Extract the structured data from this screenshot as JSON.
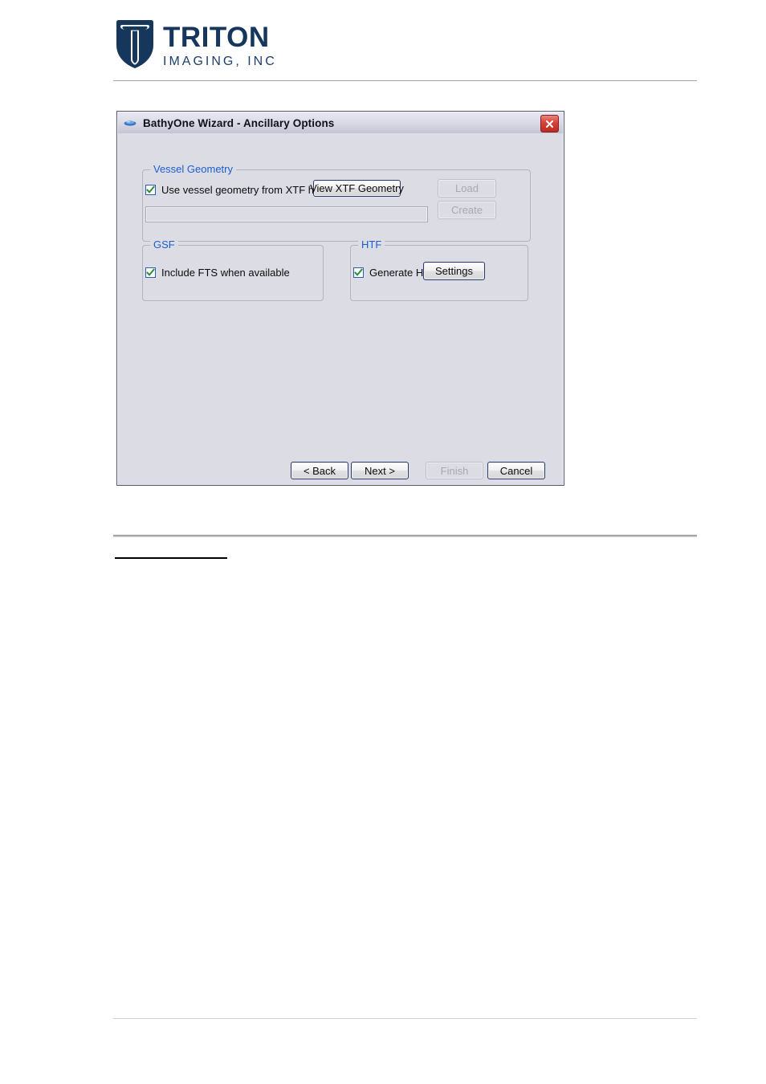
{
  "page": {
    "header": {
      "logo": {
        "shield_icon": "triton-shield-icon",
        "title": "TRITON",
        "subtitle": "IMAGING, INC",
        "brand_color": "#16365c"
      }
    }
  },
  "dialog": {
    "titlebar": {
      "icon": "bathyone-wave-icon",
      "title": "BathyOne Wizard - Ancillary Options",
      "close_icon": "close-icon",
      "close_color": "#c8342a"
    },
    "groups": {
      "vessel_geometry": {
        "legend": "Vessel Geometry",
        "legend_color": "#1b5ecb",
        "checkbox": {
          "label": "Use vessel geometry from XTF header",
          "checked": true,
          "check_color": "#2e8b34"
        },
        "view_button": {
          "label": "View XTF Geometry",
          "enabled": true,
          "focused": true
        },
        "path_field": {
          "value": "",
          "placeholder": "",
          "enabled": false
        },
        "load_button": {
          "label": "Load",
          "enabled": false
        },
        "create_button": {
          "label": "Create",
          "enabled": false
        }
      },
      "gsf": {
        "legend": "GSF",
        "checkbox": {
          "label": "Include FTS when available",
          "checked": true
        }
      },
      "htf": {
        "legend": "HTF",
        "checkbox": {
          "label": "Generate HTF",
          "checked": true
        },
        "settings_button": {
          "label": "Settings",
          "enabled": true
        }
      }
    },
    "nav": {
      "back": {
        "label": "< Back",
        "enabled": true
      },
      "next": {
        "label": "Next >",
        "enabled": true
      },
      "finish": {
        "label": "Finish",
        "enabled": false
      },
      "cancel": {
        "label": "Cancel",
        "enabled": true
      }
    }
  }
}
